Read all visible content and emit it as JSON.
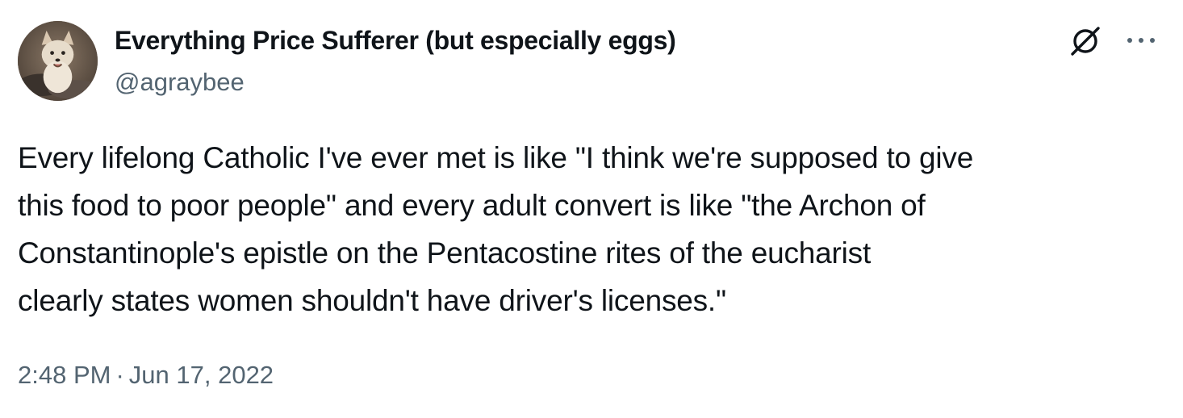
{
  "author": {
    "display_name": "Everything Price Sufferer (but especially eggs)",
    "handle": "@agraybee",
    "avatar_icon": "dog-avatar"
  },
  "tweet": {
    "text_lines": [
      "Every lifelong Catholic I've ever met is like \"I think we're supposed to give",
      "this food to poor people\" and every adult convert is like \"the Archon of",
      "Constantinople's epistle on the Pentacostine rites of the eucharist",
      "clearly states women shouldn't have driver's licenses.\""
    ],
    "time": "2:48 PM",
    "separator": "·",
    "date": "Jun 17, 2022"
  },
  "actions": {
    "grok_icon": "grok-icon",
    "more_icon": "more-options-icon"
  },
  "colors": {
    "text": "#0f1419",
    "secondary": "#536471",
    "background": "#ffffff"
  }
}
